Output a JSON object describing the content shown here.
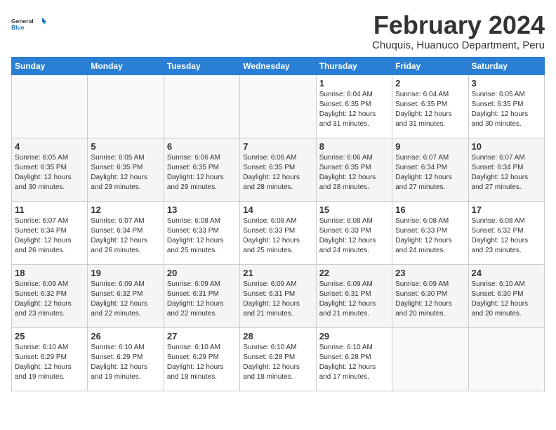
{
  "logo": {
    "general": "General",
    "blue": "Blue"
  },
  "title": "February 2024",
  "subtitle": "Chuquis, Huanuco Department, Peru",
  "days_header": [
    "Sunday",
    "Monday",
    "Tuesday",
    "Wednesday",
    "Thursday",
    "Friday",
    "Saturday"
  ],
  "weeks": [
    [
      {
        "num": "",
        "info": ""
      },
      {
        "num": "",
        "info": ""
      },
      {
        "num": "",
        "info": ""
      },
      {
        "num": "",
        "info": ""
      },
      {
        "num": "1",
        "info": "Sunrise: 6:04 AM\nSunset: 6:35 PM\nDaylight: 12 hours and 31 minutes."
      },
      {
        "num": "2",
        "info": "Sunrise: 6:04 AM\nSunset: 6:35 PM\nDaylight: 12 hours and 31 minutes."
      },
      {
        "num": "3",
        "info": "Sunrise: 6:05 AM\nSunset: 6:35 PM\nDaylight: 12 hours and 30 minutes."
      }
    ],
    [
      {
        "num": "4",
        "info": "Sunrise: 6:05 AM\nSunset: 6:35 PM\nDaylight: 12 hours and 30 minutes."
      },
      {
        "num": "5",
        "info": "Sunrise: 6:05 AM\nSunset: 6:35 PM\nDaylight: 12 hours and 29 minutes."
      },
      {
        "num": "6",
        "info": "Sunrise: 6:06 AM\nSunset: 6:35 PM\nDaylight: 12 hours and 29 minutes."
      },
      {
        "num": "7",
        "info": "Sunrise: 6:06 AM\nSunset: 6:35 PM\nDaylight: 12 hours and 28 minutes."
      },
      {
        "num": "8",
        "info": "Sunrise: 6:06 AM\nSunset: 6:35 PM\nDaylight: 12 hours and 28 minutes."
      },
      {
        "num": "9",
        "info": "Sunrise: 6:07 AM\nSunset: 6:34 PM\nDaylight: 12 hours and 27 minutes."
      },
      {
        "num": "10",
        "info": "Sunrise: 6:07 AM\nSunset: 6:34 PM\nDaylight: 12 hours and 27 minutes."
      }
    ],
    [
      {
        "num": "11",
        "info": "Sunrise: 6:07 AM\nSunset: 6:34 PM\nDaylight: 12 hours and 26 minutes."
      },
      {
        "num": "12",
        "info": "Sunrise: 6:07 AM\nSunset: 6:34 PM\nDaylight: 12 hours and 26 minutes."
      },
      {
        "num": "13",
        "info": "Sunrise: 6:08 AM\nSunset: 6:33 PM\nDaylight: 12 hours and 25 minutes."
      },
      {
        "num": "14",
        "info": "Sunrise: 6:08 AM\nSunset: 6:33 PM\nDaylight: 12 hours and 25 minutes."
      },
      {
        "num": "15",
        "info": "Sunrise: 6:08 AM\nSunset: 6:33 PM\nDaylight: 12 hours and 24 minutes."
      },
      {
        "num": "16",
        "info": "Sunrise: 6:08 AM\nSunset: 6:33 PM\nDaylight: 12 hours and 24 minutes."
      },
      {
        "num": "17",
        "info": "Sunrise: 6:08 AM\nSunset: 6:32 PM\nDaylight: 12 hours and 23 minutes."
      }
    ],
    [
      {
        "num": "18",
        "info": "Sunrise: 6:09 AM\nSunset: 6:32 PM\nDaylight: 12 hours and 23 minutes."
      },
      {
        "num": "19",
        "info": "Sunrise: 6:09 AM\nSunset: 6:32 PM\nDaylight: 12 hours and 22 minutes."
      },
      {
        "num": "20",
        "info": "Sunrise: 6:09 AM\nSunset: 6:31 PM\nDaylight: 12 hours and 22 minutes."
      },
      {
        "num": "21",
        "info": "Sunrise: 6:09 AM\nSunset: 6:31 PM\nDaylight: 12 hours and 21 minutes."
      },
      {
        "num": "22",
        "info": "Sunrise: 6:09 AM\nSunset: 6:31 PM\nDaylight: 12 hours and 21 minutes."
      },
      {
        "num": "23",
        "info": "Sunrise: 6:09 AM\nSunset: 6:30 PM\nDaylight: 12 hours and 20 minutes."
      },
      {
        "num": "24",
        "info": "Sunrise: 6:10 AM\nSunset: 6:30 PM\nDaylight: 12 hours and 20 minutes."
      }
    ],
    [
      {
        "num": "25",
        "info": "Sunrise: 6:10 AM\nSunset: 6:29 PM\nDaylight: 12 hours and 19 minutes."
      },
      {
        "num": "26",
        "info": "Sunrise: 6:10 AM\nSunset: 6:29 PM\nDaylight: 12 hours and 19 minutes."
      },
      {
        "num": "27",
        "info": "Sunrise: 6:10 AM\nSunset: 6:29 PM\nDaylight: 12 hours and 18 minutes."
      },
      {
        "num": "28",
        "info": "Sunrise: 6:10 AM\nSunset: 6:28 PM\nDaylight: 12 hours and 18 minutes."
      },
      {
        "num": "29",
        "info": "Sunrise: 6:10 AM\nSunset: 6:28 PM\nDaylight: 12 hours and 17 minutes."
      },
      {
        "num": "",
        "info": ""
      },
      {
        "num": "",
        "info": ""
      }
    ]
  ]
}
